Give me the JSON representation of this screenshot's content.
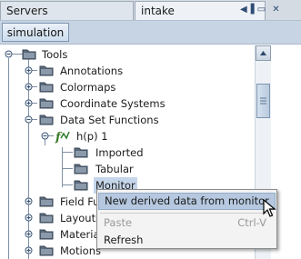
{
  "tabs": {
    "servers": "Servers",
    "intake": "intake"
  },
  "subtab": {
    "label": "simulation"
  },
  "tree": {
    "root": "Tools",
    "items": [
      {
        "label": "Annotations"
      },
      {
        "label": "Colormaps"
      },
      {
        "label": "Coordinate Systems"
      },
      {
        "label": "Data Set Functions"
      },
      {
        "label": "h(p) 1"
      },
      {
        "label": "Imported"
      },
      {
        "label": "Tabular"
      },
      {
        "label": "Monitor"
      },
      {
        "label": "Field Fu"
      },
      {
        "label": "Layouts"
      },
      {
        "label": "Materia"
      },
      {
        "label": "Motions"
      }
    ]
  },
  "context_menu": {
    "items": [
      {
        "label": "New derived data from monitor",
        "highlighted": true
      },
      {
        "label": "Paste",
        "shortcut": "Ctrl-V",
        "disabled": true
      },
      {
        "label": "Refresh"
      }
    ]
  },
  "colors": {
    "selection": "#c5d6ea",
    "menu_highlight": "#b5c8df",
    "folder": "#5b6b7d"
  }
}
